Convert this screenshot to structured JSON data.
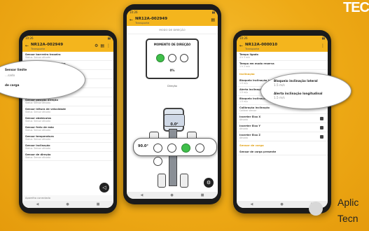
{
  "brand": {
    "logo_text": "TEC",
    "caption_line1": "Aplic",
    "caption_line2": "Tecn"
  },
  "colors": {
    "accent": "#f4b51d",
    "background": "#eeaa16",
    "green_led": "#3fbf4a"
  },
  "left_phone": {
    "status_time": "10:26",
    "title": "NR12A-002949",
    "subtitle": "Transporte",
    "items": [
      {
        "label": "Sensor barrreira traseira",
        "sub": "Status: Sensor ativado"
      },
      {
        "label": "Sensor de barreira dianteira",
        "sub": "Status: Sensor ativado"
      },
      {
        "label": "Sensor limite de carga",
        "sub": "Status: Sensor ativado"
      },
      {
        "label": "Sensor de carga",
        "sub": "Status: Sensor ativado"
      },
      {
        "label": "Sensor elevação traseiro",
        "sub": "Status: Sensor ativado"
      },
      {
        "label": "Sensor posição direção",
        "sub": "Status: Sensor ativado"
      },
      {
        "label": "Sensor leitura de velocidade",
        "sub": "Status: Sensor ativado"
      },
      {
        "label": "Sensor obstáculos",
        "sub": "Status: Sensor ativado"
      },
      {
        "label": "Sensor freio de mão",
        "sub": "Status: Sensor ativado"
      },
      {
        "label": "Sensor temperatura",
        "sub": "Status: Sensor ativado"
      },
      {
        "label": "Sensor inclinação",
        "sub": "Status: Sensor ativado"
      },
      {
        "label": "Sensor de direção",
        "sub": "Status: Sensor ativado"
      }
    ],
    "callout_line1": "Sensor limite",
    "callout_line2": "de carga",
    "callout_small": "…sado",
    "footer_text": "Aparelho conectado"
  },
  "center_phone": {
    "status_time": "10:26",
    "title": "NR12A-002949",
    "subtitle": "Transporte",
    "header_label": "MODO DE DIREÇÃO",
    "card_title": "MOMENTO DE DIREÇÃO",
    "card_value": "0%",
    "diagram_label": "Direção",
    "top_angle": "0.0°",
    "side_angle": "90.0°",
    "leds_top": [
      "on",
      "off",
      "off"
    ],
    "leds_row": [
      "off",
      "off",
      "on",
      "off",
      "off"
    ]
  },
  "right_phone": {
    "status_time": "10:26",
    "title": "NR12A-000010",
    "subtitle": "Transporte",
    "rows": [
      {
        "label": "Tempo ligado",
        "sub": "4 h 5 min"
      },
      {
        "label": "Tempo em modo reserva",
        "sub": "1 h 2 min"
      },
      {
        "label": "Bloqueio inclinação lateral",
        "sub": "1.5 m/s"
      },
      {
        "label": "Alerta inclinação longitudinal",
        "sub": "1.5 m/s"
      },
      {
        "label": "Bloqueio inclinação longitudinal",
        "sub": "1.5 m/s"
      },
      {
        "label": "Calibração inclinação",
        "sub": "Calibrar sensor"
      },
      {
        "label": "Inverter Eixo X",
        "sub": "Ativado"
      },
      {
        "label": "Inverter Eixo Y",
        "sub": "Ativado"
      },
      {
        "label": "Inverter Eixo Z",
        "sub": "Ativado"
      }
    ],
    "section_header": "Inclinação",
    "section_header2": "Sensor de carga",
    "bottom_item": "Sensor de carga presente",
    "callout_line1": "Bloqueio inclinação lateral",
    "callout_line1_sub": "1.5 m/s",
    "callout_line2": "Alerta inclinação longitudinal",
    "callout_line2_sub": "1.5 m/s"
  }
}
